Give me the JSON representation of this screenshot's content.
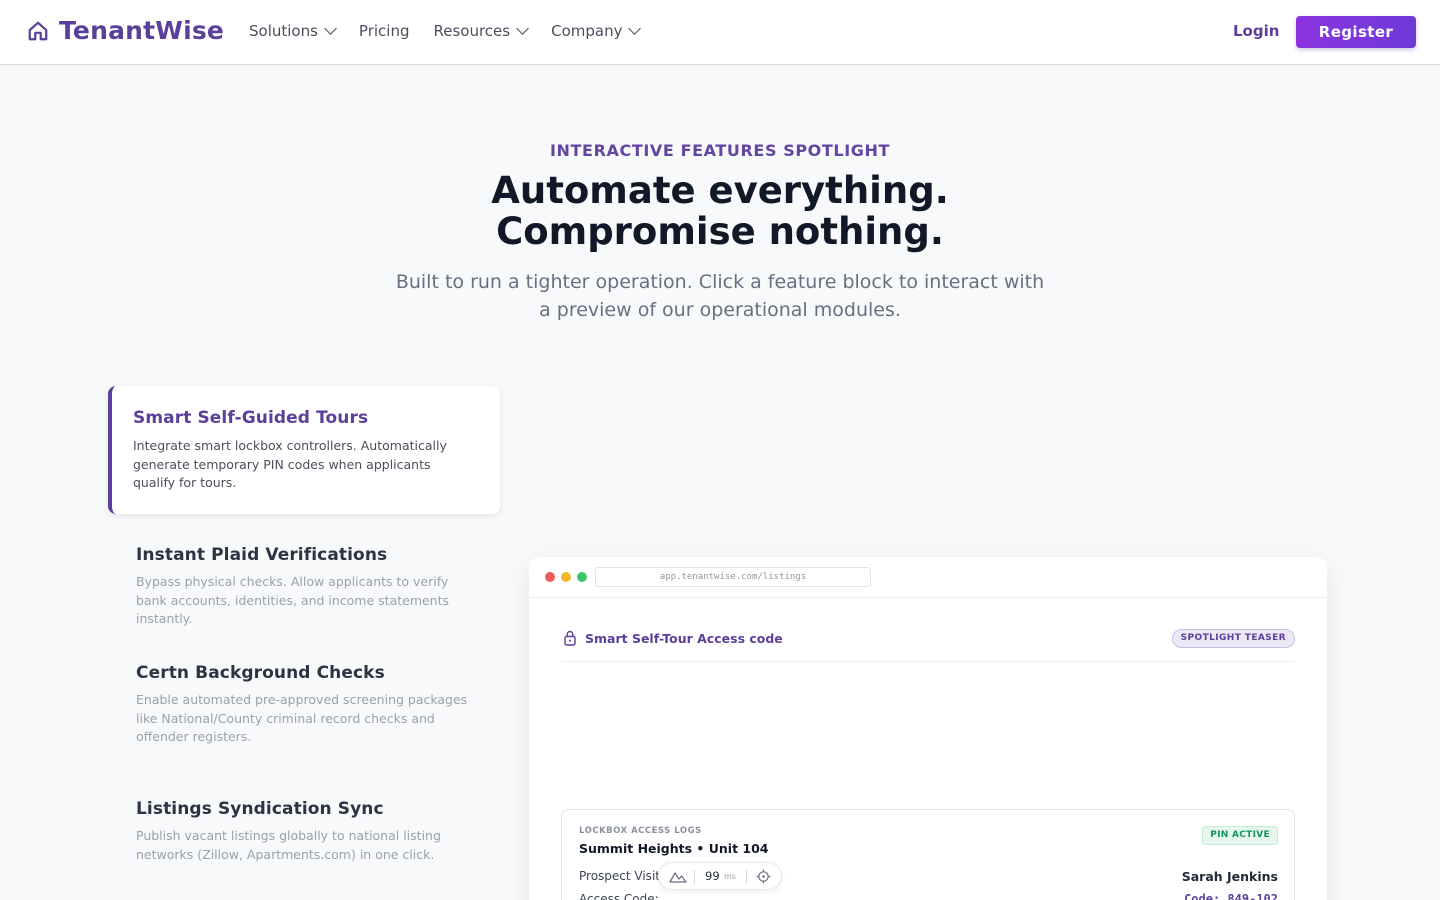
{
  "nav": {
    "brand": "TenantWise",
    "items": [
      {
        "label": "Solutions",
        "has_dropdown": true
      },
      {
        "label": "Pricing",
        "has_dropdown": false
      },
      {
        "label": "Resources",
        "has_dropdown": true
      },
      {
        "label": "Company",
        "has_dropdown": true
      }
    ],
    "login_label": "Login",
    "register_label": "Register"
  },
  "hero": {
    "eyebrow": "INTERACTIVE FEATURES SPOTLIGHT",
    "headline": "Automate everything. Compromise nothing.",
    "subtitle": "Built to run a tighter operation. Click a feature block to interact with a preview of our operational modules."
  },
  "features": [
    {
      "title": "Smart Self-Guided Tours",
      "description": "Integrate smart lockbox controllers. Automatically generate temporary PIN codes when applicants qualify for tours.",
      "active": true
    },
    {
      "title": "Instant Plaid Verifications",
      "description": "Bypass physical checks. Allow applicants to verify bank accounts, identities, and income statements instantly.",
      "active": false
    },
    {
      "title": "Certn Background Checks",
      "description": "Enable automated pre-approved screening packages like National/County criminal record checks and offender registers.",
      "active": false
    },
    {
      "title": "Listings Syndication Sync",
      "description": "Publish vacant listings globally to national listing networks (Zillow, Apartments.com) in one click.",
      "active": false
    }
  ],
  "preview": {
    "url": "app.tenantwise.com/listings",
    "panel_title": "Smart Self-Tour Access code",
    "badge": "SPOTLIGHT TEASER",
    "card": {
      "caption": "LOCKBOX ACCESS LOGS",
      "title": "Summit Heights • Unit 104",
      "status": "PIN ACTIVE",
      "prospect_label": "Prospect Visit",
      "prospect_value": "Sarah Jenkins",
      "code_label": "Access Code:",
      "code_value": "Code: 849-102"
    }
  },
  "widget": {
    "value": "99",
    "unit": "ms"
  },
  "colors": {
    "brand": "#5b3f9b",
    "register_gradient_start": "#8b34e0",
    "register_gradient_end": "#6f3ad8",
    "status_green": "#14935a",
    "window_dot_red": "#f05a5a",
    "window_dot_yellow": "#f3b72e",
    "window_dot_green": "#3ec46d"
  },
  "icons": {
    "brand": "home-icon",
    "dropdown": "chevron-down-icon",
    "panel": "lock-icon",
    "widget_left": "mountains-icon",
    "widget_right": "crosshair-icon"
  }
}
